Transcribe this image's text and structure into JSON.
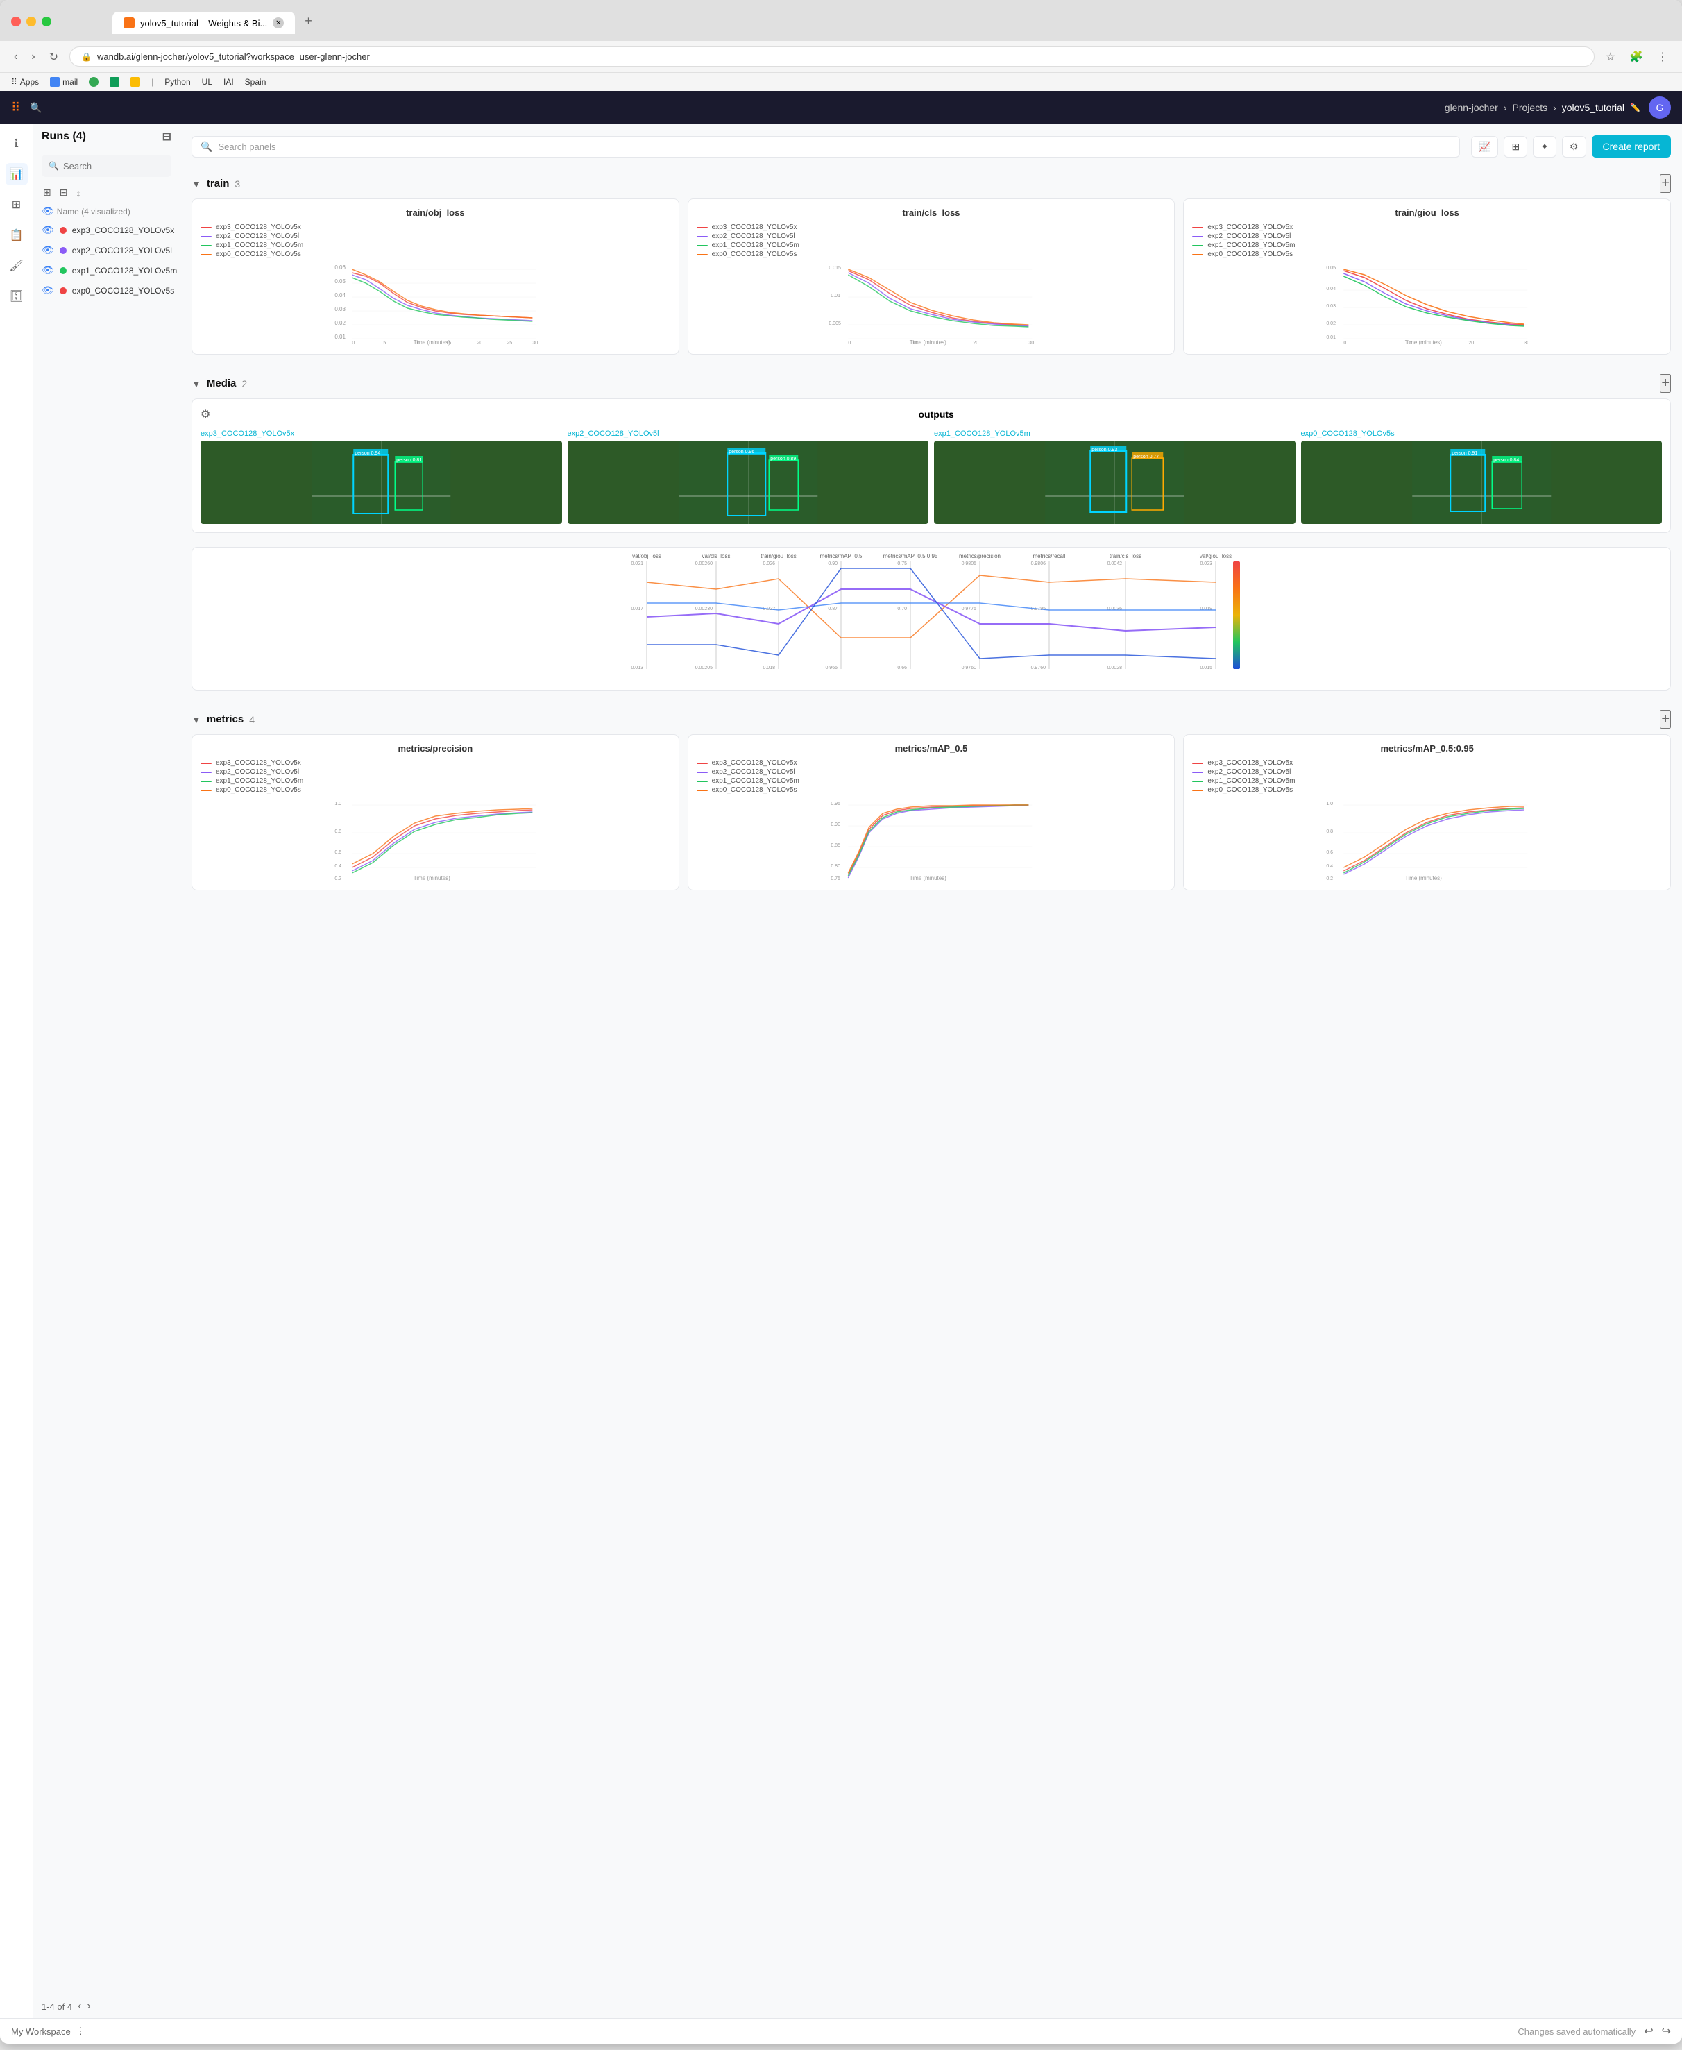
{
  "browser": {
    "tab_title": "yolov5_tutorial – Weights & Bi...",
    "url": "wandb.ai/glenn-jocher/yolov5_tutorial?workspace=user-glenn-jocher",
    "bookmarks": [
      "Apps",
      "mail",
      "Python",
      "UL",
      "IAI",
      "Spain"
    ]
  },
  "app": {
    "logo": "⠿",
    "breadcrumb": {
      "user": "glenn-jocher",
      "sep1": "›",
      "project": "Projects",
      "sep2": "›",
      "workspace": "yolov5_tutorial"
    }
  },
  "sidebar": {
    "runs_title": "Runs (4)",
    "search_placeholder": "Search",
    "group_label": "Name (4 visualized)",
    "runs": [
      {
        "name": "exp3_COCO128_YOLOv5x",
        "color": "#ef4444",
        "id": "run-0"
      },
      {
        "name": "exp2_COCO128_YOLOv5l",
        "color": "#8b5cf6",
        "id": "run-1"
      },
      {
        "name": "exp1_COCO128_YOLOv5m",
        "color": "#22c55e",
        "id": "run-2"
      },
      {
        "name": "exp0_COCO128_YOLOv5s",
        "color": "#ef4444",
        "id": "run-3"
      }
    ],
    "pagination": "1-4 of 4"
  },
  "main": {
    "search_placeholder": "Search panels",
    "create_report_label": "Create report",
    "sections": [
      {
        "id": "train",
        "label": "train",
        "count": "3",
        "charts": [
          {
            "title": "train/obj_loss",
            "y_max": 0.06,
            "y_min": 0,
            "x_label": "Time (minutes)",
            "x_max": 30
          },
          {
            "title": "train/cls_loss",
            "y_max": 0.015,
            "y_min": 0,
            "x_label": "Time (minutes)",
            "x_max": 30
          },
          {
            "title": "train/giou_loss",
            "y_max": 0.05,
            "y_min": 0,
            "x_label": "Time (minutes)",
            "x_max": 30
          }
        ]
      },
      {
        "id": "media",
        "label": "Media",
        "count": "2",
        "panel_title": "outputs",
        "images": [
          {
            "label": "exp3_COCO128_YOLOv5x"
          },
          {
            "label": "exp2_COCO128_YOLOv5l"
          },
          {
            "label": "exp1_COCO128_YOLOv5m"
          },
          {
            "label": "exp0_COCO128_YOLOv5s"
          }
        ]
      },
      {
        "id": "metrics",
        "label": "metrics",
        "count": "4",
        "charts": [
          {
            "title": "metrics/precision",
            "y_max": 1.0,
            "y_min": 0,
            "x_label": "Time (minutes)"
          },
          {
            "title": "metrics/mAP_0.5",
            "y_max": 1.0,
            "y_min": 0.7,
            "x_label": "Time (minutes)"
          },
          {
            "title": "metrics/mAP_0.5:0.95",
            "y_max": 1.0,
            "y_min": 0,
            "x_label": "Time (minutes)"
          }
        ]
      }
    ],
    "parallel_coords": {
      "columns": [
        "val/obj_loss",
        "val/cls_loss",
        "train/giou_loss",
        "metrics/mAP_0.5",
        "metrics/mAP_0.5:0.95",
        "metrics/precision",
        "metrics/recall",
        "train/cls_loss",
        "val/giou_loss"
      ]
    }
  },
  "footer": {
    "workspace_label": "My Workspace",
    "auto_save": "Changes saved automatically"
  },
  "colors": {
    "accent": "#06b6d4",
    "run1": "#ef4444",
    "run2": "#8b5cf6",
    "run3": "#22c55e",
    "run4": "#f97316",
    "dark_bg": "#1a1a2e"
  },
  "legend": {
    "items": [
      {
        "label": "exp3_COCO128_YOLOv5x",
        "color": "#ef4444"
      },
      {
        "label": "exp2_COCO128_YOLOv5l",
        "color": "#8b5cf6"
      },
      {
        "label": "exp1_COCO128_YOLOv5m",
        "color": "#22c55e"
      },
      {
        "label": "exp0_COCO128_YOLOv5s",
        "color": "#f97316"
      }
    ]
  }
}
